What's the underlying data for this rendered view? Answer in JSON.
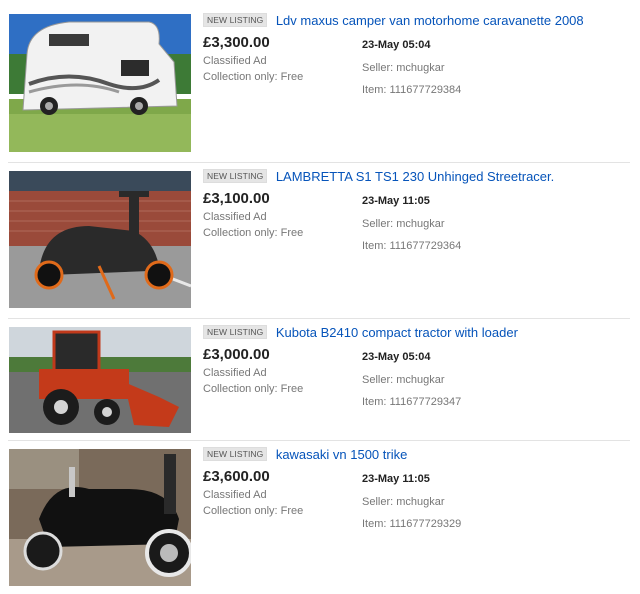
{
  "listings": [
    {
      "badge": "NEW LISTING",
      "title": "Ldv maxus camper van motorhome caravanette 2008",
      "price": "£3,300.00",
      "ad_type": "Classified Ad",
      "collection": "Collection only: Free",
      "time": "23-May 05:04",
      "seller": "Seller: mchugkar",
      "item": "Item: 111677729384",
      "image": "camper-van-photo"
    },
    {
      "badge": "NEW LISTING",
      "title": "LAMBRETTA S1 TS1 230 Unhinged Streetracer.",
      "price": "£3,100.00",
      "ad_type": "Classified Ad",
      "collection": "Collection only: Free",
      "time": "23-May 11:05",
      "seller": "Seller: mchugkar",
      "item": "Item: 111677729364",
      "image": "scooter-photo"
    },
    {
      "badge": "NEW LISTING",
      "title": "Kubota B2410 compact tractor with loader",
      "price": "£3,000.00",
      "ad_type": "Classified Ad",
      "collection": "Collection only: Free",
      "time": "23-May 05:04",
      "seller": "Seller: mchugkar",
      "item": "Item: 111677729347",
      "image": "tractor-photo"
    },
    {
      "badge": "NEW LISTING",
      "title": "kawasaki vn 1500 trike",
      "price": "£3,600.00",
      "ad_type": "Classified Ad",
      "collection": "Collection only: Free",
      "time": "23-May 11:05",
      "seller": "Seller: mchugkar",
      "item": "Item: 111677729329",
      "image": "trike-photo"
    }
  ],
  "colors": {
    "link": "#0654ba",
    "price": "#222222",
    "muted": "#777777",
    "badge_bg": "#e5e5e5",
    "divider": "#e3e3e3"
  }
}
